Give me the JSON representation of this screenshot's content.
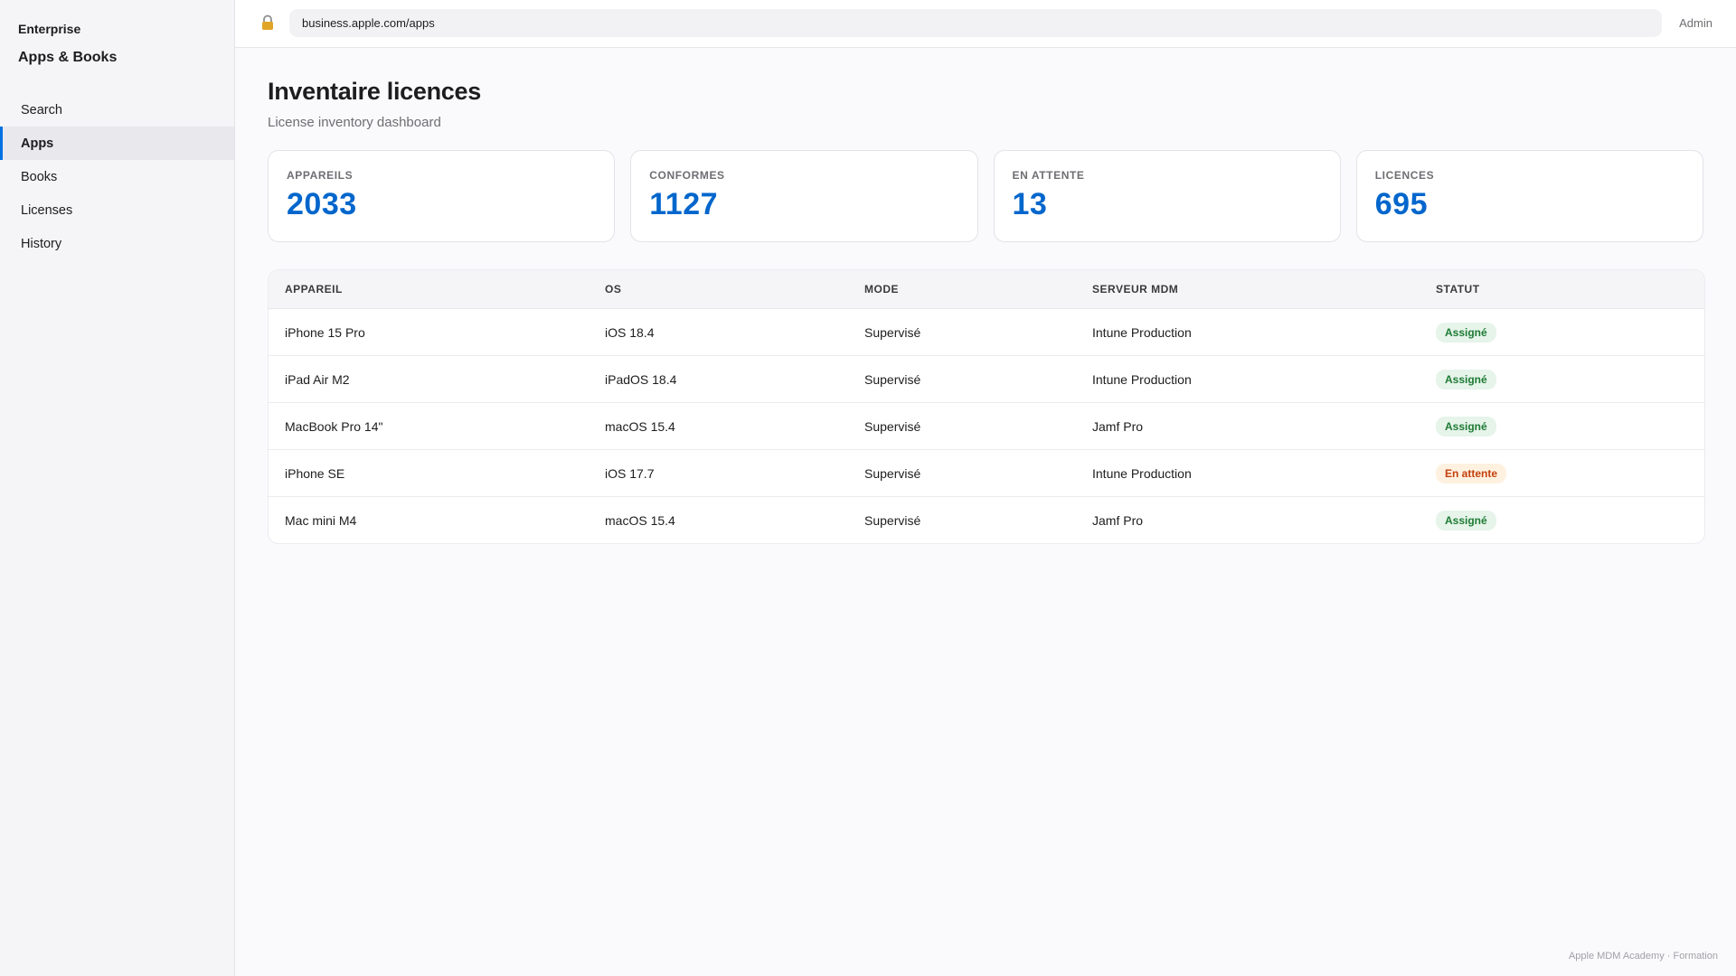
{
  "sidebar": {
    "org": "Enterprise",
    "section": "Apps & Books",
    "items": [
      {
        "label": "Search"
      },
      {
        "label": "Apps"
      },
      {
        "label": "Books"
      },
      {
        "label": "Licenses"
      },
      {
        "label": "History"
      }
    ],
    "active": "Apps"
  },
  "topbar": {
    "url": "business.apple.com/apps",
    "user": "Admin",
    "lock_icon": "lock-icon"
  },
  "page": {
    "title": "Inventaire licences",
    "subtitle": "License inventory dashboard"
  },
  "stats": [
    {
      "label": "APPAREILS",
      "value": "2033"
    },
    {
      "label": "CONFORMES",
      "value": "1127"
    },
    {
      "label": "EN ATTENTE",
      "value": "13"
    },
    {
      "label": "LICENCES",
      "value": "695"
    }
  ],
  "table": {
    "columns": [
      "APPAREIL",
      "OS",
      "MODE",
      "SERVEUR MDM",
      "STATUT"
    ],
    "rows": [
      {
        "device": "iPhone 15 Pro",
        "os": "iOS 18.4",
        "mode": "Supervisé",
        "server": "Intune Production",
        "status": "Assigné"
      },
      {
        "device": "iPad Air M2",
        "os": "iPadOS 18.4",
        "mode": "Supervisé",
        "server": "Intune Production",
        "status": "Assigné"
      },
      {
        "device": "MacBook Pro 14\"",
        "os": "macOS 15.4",
        "mode": "Supervisé",
        "server": "Jamf Pro",
        "status": "Assigné"
      },
      {
        "device": "iPhone SE",
        "os": "iOS 17.7",
        "mode": "Supervisé",
        "server": "Intune Production",
        "status": "En attente"
      },
      {
        "device": "Mac mini M4",
        "os": "macOS 15.4",
        "mode": "Supervisé",
        "server": "Jamf Pro",
        "status": "Assigné"
      }
    ]
  },
  "colors": {
    "accent": "#0066cc",
    "status_ok": "#1e7b34",
    "status_pending": "#c2410c"
  },
  "footer": "Apple MDM Academy · Formation"
}
